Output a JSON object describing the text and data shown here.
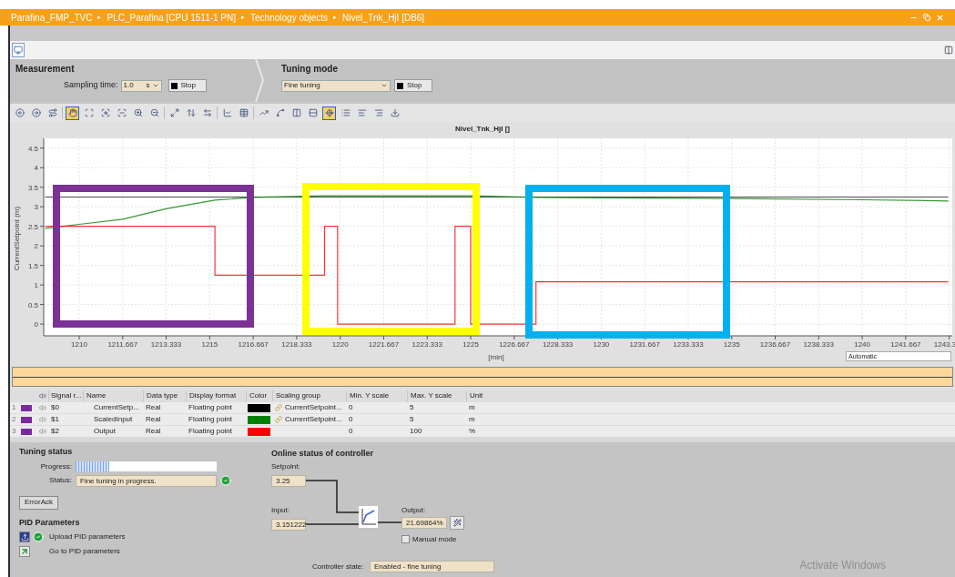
{
  "breadcrumb": [
    "Parafina_FMP_TVC",
    "PLC_Parafina [CPU 1511-1 PN]",
    "Technology objects",
    "Nivel_Tnk_HjI [DB6]"
  ],
  "breadcrumb_separator": "▸",
  "measurement": {
    "title": "Measurement",
    "sampling_label": "Sampling time:",
    "sampling_value": "1.0",
    "sampling_unit": "s",
    "stop_label": "Stop"
  },
  "tuning_mode": {
    "title": "Tuning mode",
    "value": "Fine tuning",
    "stop_label": "Stop"
  },
  "toolbar": [
    {
      "kind": "back",
      "selected": false
    },
    {
      "kind": "forward",
      "selected": false
    },
    {
      "kind": "route",
      "selected": false
    },
    {
      "kind": "separator"
    },
    {
      "kind": "hand",
      "selected": true
    },
    {
      "kind": "zoom-box",
      "selected": false
    },
    {
      "kind": "zoom-x",
      "selected": false
    },
    {
      "kind": "zoom-y",
      "selected": false
    },
    {
      "kind": "zoom-in",
      "selected": false
    },
    {
      "kind": "zoom-out",
      "selected": false
    },
    {
      "kind": "separator"
    },
    {
      "kind": "fit",
      "selected": false
    },
    {
      "kind": "fit-y",
      "selected": false
    },
    {
      "kind": "fit-x",
      "selected": false
    },
    {
      "kind": "separator"
    },
    {
      "kind": "chart",
      "selected": false
    },
    {
      "kind": "table",
      "selected": false
    },
    {
      "kind": "separator"
    },
    {
      "kind": "trend",
      "selected": false
    },
    {
      "kind": "spline",
      "selected": false
    },
    {
      "kind": "columns",
      "selected": false
    },
    {
      "kind": "rows",
      "selected": false
    },
    {
      "kind": "locate",
      "selected": true
    },
    {
      "kind": "list",
      "selected": false
    },
    {
      "kind": "align-left",
      "selected": false
    },
    {
      "kind": "align-right",
      "selected": false
    },
    {
      "kind": "download",
      "selected": false
    }
  ],
  "trend": {
    "axis_mode": "Automatic",
    "highlight_frames": [
      {
        "color": "#7b3294"
      },
      {
        "color": "#ffff00"
      },
      {
        "color": "#00b0f0"
      }
    ],
    "chart_data": {
      "type": "line",
      "title": "Nivel_Tnk_HjI []",
      "xlabel": "[min]",
      "ylabel": "CurrentSetpoint (m)",
      "grid": true,
      "x": [
        1208.7,
        1210,
        1211.667,
        1213.333,
        1215,
        1215.2,
        1215.2,
        1216.667,
        1219.4,
        1219.4,
        1219.9,
        1219.9,
        1224.4,
        1224.4,
        1225,
        1225,
        1227.5,
        1227.5,
        1230,
        1235,
        1240,
        1243.3
      ],
      "series": [
        {
          "color": "#000000",
          "values": [
            3.25,
            3.25,
            3.25,
            3.25,
            3.25,
            3.25,
            3.25,
            3.25,
            3.25,
            3.25,
            3.25,
            3.25,
            3.25,
            3.25,
            3.25,
            3.25,
            3.25,
            3.25,
            3.25,
            3.25,
            3.25,
            3.25
          ]
        },
        {
          "color": "#008000",
          "values": [
            2.45,
            2.55,
            2.68,
            2.95,
            3.15,
            3.17,
            3.17,
            3.24,
            3.28,
            3.28,
            3.28,
            3.28,
            3.28,
            3.28,
            3.28,
            3.28,
            3.24,
            3.24,
            3.23,
            3.21,
            3.18,
            3.15
          ]
        },
        {
          "color": "#ff0000",
          "values": [
            2.5,
            2.5,
            2.5,
            2.5,
            2.5,
            2.5,
            1.25,
            1.25,
            1.25,
            2.5,
            2.5,
            0,
            0,
            2.5,
            2.5,
            0,
            0,
            1.08,
            1.08,
            1.08,
            1.08,
            1.08
          ]
        }
      ],
      "xlim": [
        1208.64,
        1243.45
      ],
      "ylim": [
        -0.3,
        4.75
      ],
      "xticks": [
        {
          "value": 1210,
          "label": "1210"
        },
        {
          "value": 1211.667,
          "label": "1211.667"
        },
        {
          "value": 1213.333,
          "label": "1213.333"
        },
        {
          "value": 1215,
          "label": "1215"
        },
        {
          "value": 1216.667,
          "label": "1216.667"
        },
        {
          "value": 1218.333,
          "label": "1218.333"
        },
        {
          "value": 1220,
          "label": "1220"
        },
        {
          "value": 1221.667,
          "label": "1221.667"
        },
        {
          "value": 1223.333,
          "label": "1223.333"
        },
        {
          "value": 1225,
          "label": "1225"
        },
        {
          "value": 1226.667,
          "label": "1226.667"
        },
        {
          "value": 1228.333,
          "label": "1228.333"
        },
        {
          "value": 1230,
          "label": "1230"
        },
        {
          "value": 1231.667,
          "label": "1231.667"
        },
        {
          "value": 1233.333,
          "label": "1233.333"
        },
        {
          "value": 1235,
          "label": "1235"
        },
        {
          "value": 1236.667,
          "label": "1236.667"
        },
        {
          "value": 1238.333,
          "label": "1238.333"
        },
        {
          "value": 1240,
          "label": "1240"
        },
        {
          "value": 1241.667,
          "label": "1241.667"
        },
        {
          "value": 1243.333,
          "label": "1243.3"
        }
      ],
      "yticks": [
        {
          "value": 0,
          "label": "0"
        },
        {
          "value": 0.5,
          "label": "0.5"
        },
        {
          "value": 1,
          "label": "1"
        },
        {
          "value": 1.5,
          "label": "1.5"
        },
        {
          "value": 2,
          "label": "2"
        },
        {
          "value": 2.5,
          "label": "2.5"
        },
        {
          "value": 3,
          "label": "3"
        },
        {
          "value": 3.5,
          "label": "3.5"
        },
        {
          "value": 4,
          "label": "4"
        },
        {
          "value": 4.5,
          "label": "4.5"
        }
      ]
    }
  },
  "signal_table": {
    "columns": [
      "Signal r...",
      "Name",
      "Data type",
      "Display format",
      "Color",
      "Scaling group",
      "Min. Y scale",
      "Max. Y scale",
      "Unit"
    ],
    "rows": [
      {
        "index": "1",
        "signal": "$0",
        "name": "CurrentSetp...",
        "data_type": "Real",
        "display_format": "Floating point",
        "color": "#000000",
        "scaling_group": "CurrentSetpoint...",
        "min": "0",
        "max": "5",
        "unit": "m"
      },
      {
        "index": "2",
        "signal": "$1",
        "name": "ScaledInput",
        "data_type": "Real",
        "display_format": "Floating point",
        "color": "#008000",
        "scaling_group": "CurrentSetpoint...",
        "min": "0",
        "max": "5",
        "unit": "m"
      },
      {
        "index": "3",
        "signal": "$2",
        "name": "Output",
        "data_type": "Real",
        "display_format": "Floating point",
        "color": "#ff0000",
        "min": "0",
        "max": "100",
        "unit": "%"
      }
    ]
  },
  "tuning_status": {
    "title": "Tuning status",
    "progress_label": "Progress:",
    "progress": {
      "level": 0.24
    },
    "status_label": "Status:",
    "status_value": "Fine tuning in progress.",
    "status_ok": true,
    "error_ack": "ErrorAck"
  },
  "pid_parameters": {
    "title": "PID Parameters",
    "items": [
      {
        "kind": "upload",
        "label": "Upload PID parameters",
        "ok": true
      },
      {
        "kind": "goto",
        "label": "Go to PID parameters",
        "ok": false
      }
    ]
  },
  "online_status": {
    "title": "Online status of controller",
    "setpoint_label": "Setpoint:",
    "setpoint": "3.25",
    "input_label": "Input:",
    "input": "3.151222",
    "output_label": "Output:",
    "output": "21.69864",
    "output_unit": "%",
    "manual_mode": {
      "label": "Manual mode",
      "checked": false
    },
    "state_label": "Controller state:",
    "state": "Enabled - fine tuning"
  },
  "os_notice": "Activate Windows"
}
